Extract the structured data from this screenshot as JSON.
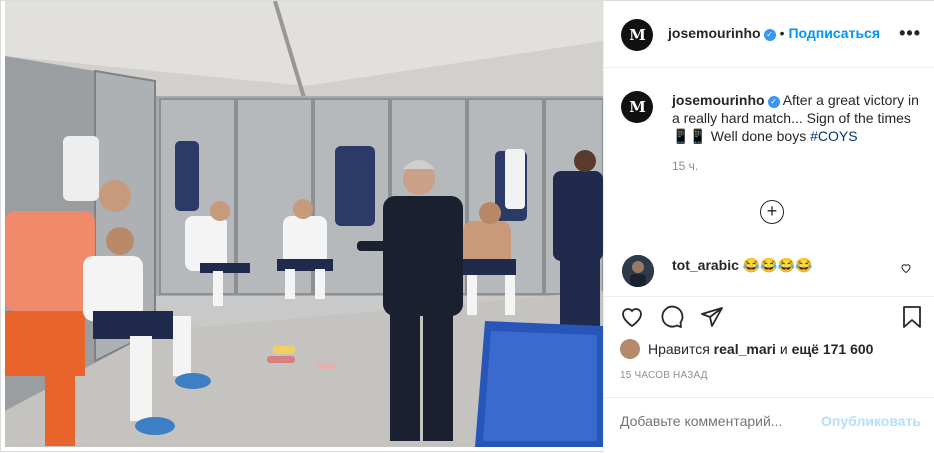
{
  "post": {
    "username": "josemourinho",
    "avatar_monogram": "M",
    "verified_icon": "verified-badge-icon",
    "follow_label": "Подписаться",
    "separator": "•",
    "more_label": "•••",
    "photo_description": "locker-room-photo",
    "caption": {
      "username": "josemourinho",
      "text": "After a great victory in a really hard match... Sign of the times 📱📱 Well done boys ",
      "hashtag": "#COYS",
      "time": "15 ч."
    },
    "load_more_label": "+",
    "comments": [
      {
        "username": "tot_arabic",
        "text": "😂😂😂😂"
      }
    ],
    "likes": {
      "prefix": "Нравится",
      "user": "real_mari",
      "middle": "и",
      "count_text": "ещё 171 600"
    },
    "posted_ago": "15 ЧАСОВ НАЗАД",
    "add_comment": {
      "placeholder": "Добавьте комментарий...",
      "publish_label": "Опубликовать"
    }
  },
  "colors": {
    "link_blue": "#0095f6",
    "publish_disabled": "#b2dffc",
    "muted": "#8e8e8e",
    "text": "#262626"
  },
  "icons": [
    "heart-icon",
    "comment-icon",
    "share-icon",
    "bookmark-icon",
    "add-comments-icon",
    "more-options-icon"
  ]
}
